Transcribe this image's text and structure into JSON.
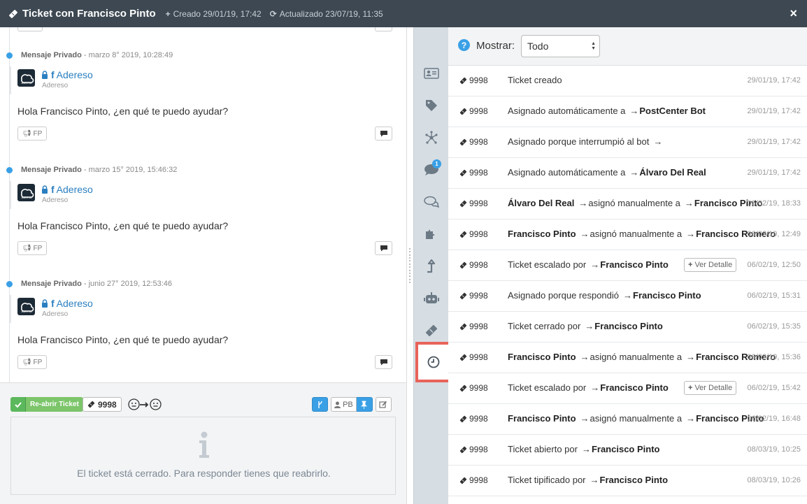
{
  "header": {
    "title": "Ticket con Francisco Pinto",
    "created": "Creado 29/01/19, 17:42",
    "updated": "Actualizado 23/07/19, 11:35",
    "close": "×"
  },
  "messages": [
    {
      "type": "Mensaje Privado",
      "date": "marzo 8° 2019, 10:28:49",
      "sender": "Adereso",
      "sender_sub": "Adereso",
      "text": "Hola Francisco Pinto, ¿en qué te puedo ayudar?",
      "tag": "FP",
      "avatar_label": "adere.so"
    },
    {
      "type": "Mensaje Privado",
      "date": "marzo 15° 2019, 15:46:32",
      "sender": "Adereso",
      "sender_sub": "Adereso",
      "text": "Hola Francisco Pinto, ¿en qué te puedo ayudar?",
      "tag": "FP",
      "avatar_label": "adere.so"
    },
    {
      "type": "Mensaje Privado",
      "date": "junio 27° 2019, 12:53:46",
      "sender": "Adereso",
      "sender_sub": "Adereso",
      "text": "Hola Francisco Pinto, ¿en qué te puedo ayudar?",
      "tag": "FP",
      "avatar_label": "adere.so"
    }
  ],
  "compose": {
    "reopen_label": "Re-abrir Ticket",
    "ticket_number": "9998",
    "user_initials": "PB",
    "closed_message": "El ticket está cerrado. Para responder tienes que reabrirlo."
  },
  "rail": {
    "chat_badge": "1"
  },
  "filter": {
    "label": "Mostrar:",
    "value": "Todo",
    "help": "?"
  },
  "history": [
    {
      "id": "9998",
      "parts": [
        {
          "t": "Ticket creado"
        }
      ],
      "date": "29/01/19, 17:42"
    },
    {
      "id": "9998",
      "parts": [
        {
          "t": "Asignado automáticamente a"
        },
        {
          "a": "→"
        },
        {
          "b": "PostCenter Bot"
        }
      ],
      "date": "29/01/19, 17:42"
    },
    {
      "id": "9998",
      "parts": [
        {
          "t": "Asignado porque interrumpió al bot"
        },
        {
          "a": "→"
        }
      ],
      "date": "29/01/19, 17:42"
    },
    {
      "id": "9998",
      "parts": [
        {
          "t": "Asignado automáticamente a"
        },
        {
          "a": "→"
        },
        {
          "b": "Álvaro Del Real"
        }
      ],
      "date": "29/01/19, 17:42"
    },
    {
      "id": "9998",
      "parts": [
        {
          "b": "Álvaro Del Real"
        },
        {
          "a": "→"
        },
        {
          "t": "asignó manualmente a"
        },
        {
          "a": "→"
        },
        {
          "b": "Francisco Pinto"
        }
      ],
      "date": "06/02/19, 18:33"
    },
    {
      "id": "9998",
      "parts": [
        {
          "b": "Francisco Pinto"
        },
        {
          "a": "→"
        },
        {
          "t": "asignó manualmente a"
        },
        {
          "a": "→"
        },
        {
          "b": "Francisco Romero"
        }
      ],
      "date": "06/02/19, 12:49"
    },
    {
      "id": "9998",
      "parts": [
        {
          "t": "Ticket escalado por"
        },
        {
          "a": "→"
        },
        {
          "b": "Francisco Pinto"
        }
      ],
      "detail": "Ver Detalle",
      "date": "06/02/19, 12:50"
    },
    {
      "id": "9998",
      "parts": [
        {
          "t": "Asignado porque respondió"
        },
        {
          "a": "→"
        },
        {
          "b": "Francisco Pinto"
        }
      ],
      "date": "06/02/19, 15:31"
    },
    {
      "id": "9998",
      "parts": [
        {
          "t": "Ticket cerrado por"
        },
        {
          "a": "→"
        },
        {
          "b": "Francisco Pinto"
        }
      ],
      "date": "06/02/19, 15:35"
    },
    {
      "id": "9998",
      "parts": [
        {
          "b": "Francisco Pinto"
        },
        {
          "a": "→"
        },
        {
          "t": "asignó manualmente a"
        },
        {
          "a": "→"
        },
        {
          "b": "Francisco Romero"
        }
      ],
      "date": "06/02/19, 15:36"
    },
    {
      "id": "9998",
      "parts": [
        {
          "t": "Ticket escalado por"
        },
        {
          "a": "→"
        },
        {
          "b": "Francisco Pinto"
        }
      ],
      "detail": "Ver Detalle",
      "date": "06/02/19, 15:42"
    },
    {
      "id": "9998",
      "parts": [
        {
          "b": "Francisco Pinto"
        },
        {
          "a": "→"
        },
        {
          "t": "asignó manualmente a"
        },
        {
          "a": "→"
        },
        {
          "b": "Francisco Pinto"
        }
      ],
      "date": "06/02/19, 16:48"
    },
    {
      "id": "9998",
      "parts": [
        {
          "t": "Ticket abierto por"
        },
        {
          "a": "→"
        },
        {
          "b": "Francisco Pinto"
        }
      ],
      "date": "08/03/19, 10:25"
    },
    {
      "id": "9998",
      "parts": [
        {
          "t": "Ticket tipificado por"
        },
        {
          "a": "→"
        },
        {
          "b": "Francisco Pinto"
        }
      ],
      "date": "08/03/19, 10:26"
    }
  ],
  "colors": {
    "header": "#3d4852",
    "accent": "#3aa0e6",
    "success": "#5cb85c",
    "highlight": "#e8645a",
    "rail": "#d6dde3"
  }
}
